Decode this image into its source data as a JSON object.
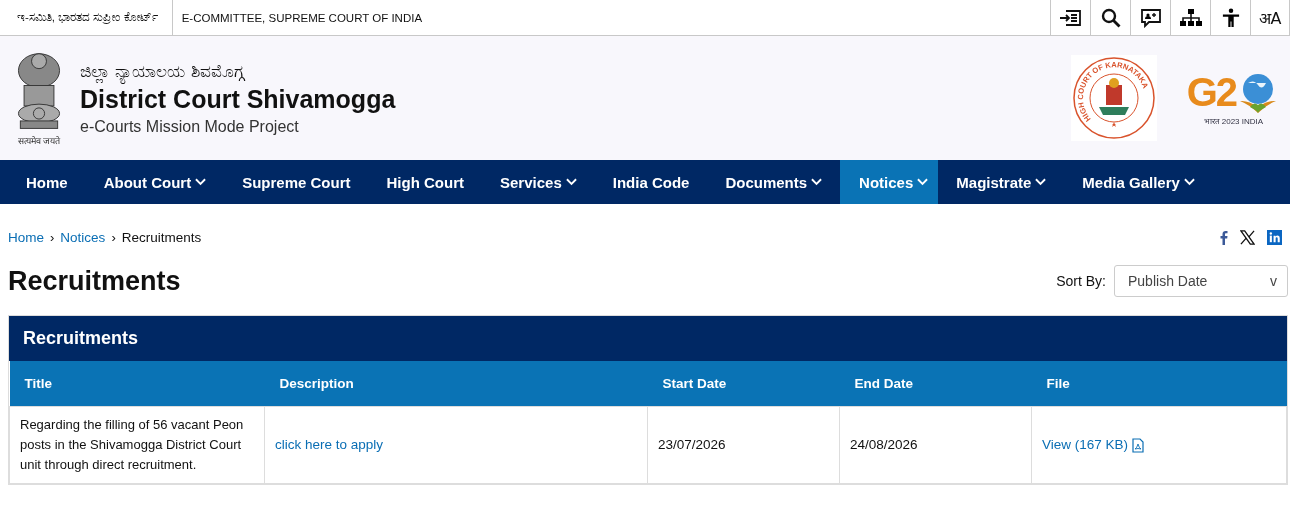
{
  "top_bar": {
    "kannada_title": "ಇ-ಸಮಿತಿ, ಭಾರತದ ಸುಪ್ರೀಂ ಕೋರ್ಟ್",
    "english_title": "E-COMMITTEE, SUPREME COURT OF INDIA",
    "language_toggle": "अA"
  },
  "header": {
    "kannada_name": "ಜಿಲ್ಲಾ ನ್ಯಾಯಾಲಯ ಶಿವಮೊಗ್ಗ",
    "name": "District Court Shivamogga",
    "tagline": "e-Courts Mission Mode Project",
    "emblem_motto": "सत्यमेव जयते",
    "seal_text": "HIGH COURT OF KARNATAKA",
    "g20_mark": "G2",
    "g20_caption": "भारत 2023 INDIA"
  },
  "nav": [
    {
      "label": "Home",
      "has_menu": false,
      "selected": false
    },
    {
      "label": "About Court",
      "has_menu": true,
      "selected": false
    },
    {
      "label": "Supreme Court",
      "has_menu": false,
      "selected": false
    },
    {
      "label": "High Court",
      "has_menu": false,
      "selected": false
    },
    {
      "label": "Services",
      "has_menu": true,
      "selected": false
    },
    {
      "label": "India Code",
      "has_menu": false,
      "selected": false
    },
    {
      "label": "Documents",
      "has_menu": true,
      "selected": false
    },
    {
      "label": "Notices",
      "has_menu": true,
      "selected": true
    },
    {
      "label": "Magistrate",
      "has_menu": true,
      "selected": false
    },
    {
      "label": "Media Gallery",
      "has_menu": true,
      "selected": false
    }
  ],
  "breadcrumb_separator": "›",
  "breadcrumb": [
    {
      "label": "Home",
      "link": true
    },
    {
      "label": "Notices",
      "link": true
    },
    {
      "label": "Recruitments",
      "link": false
    }
  ],
  "page_title": "Recruitments",
  "sort": {
    "label": "Sort By:",
    "value": "Publish Date",
    "caret": "v"
  },
  "table": {
    "heading": "Recruitments",
    "columns": [
      "Title",
      "Description",
      "Start Date",
      "End Date",
      "File"
    ],
    "rows": [
      {
        "title": "Regarding the filling of 56 vacant Peon posts in the Shivamogga District Court unit through direct recruitment.",
        "description": "click here to apply",
        "start_date": "23/07/2026",
        "end_date": "24/08/2026",
        "file": "View (167 KB)"
      }
    ]
  }
}
